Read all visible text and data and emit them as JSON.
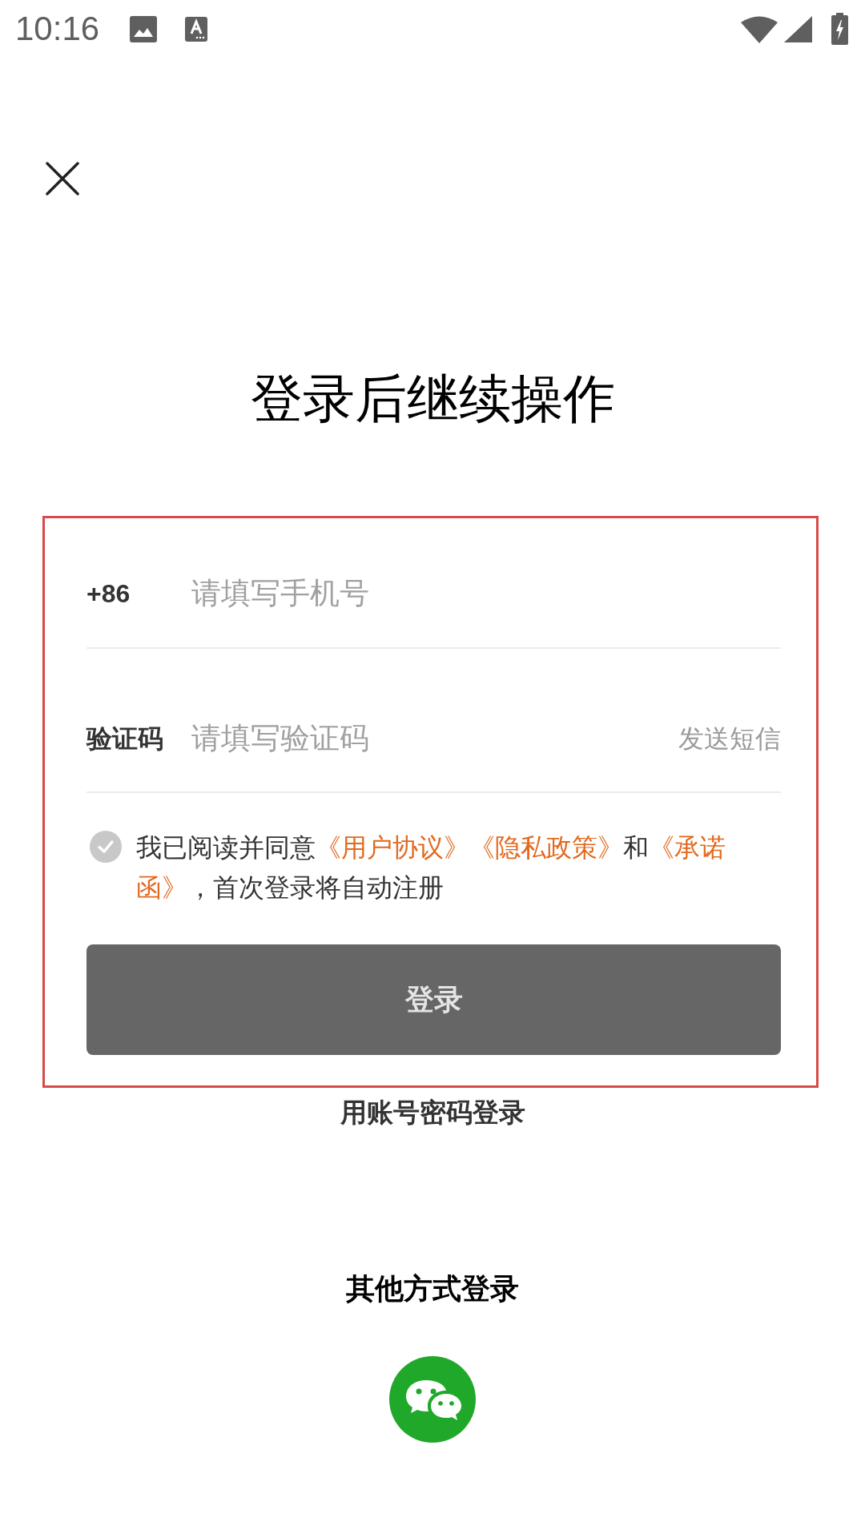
{
  "status_bar": {
    "time": "10:16"
  },
  "title": "登录后继续操作",
  "form": {
    "phone": {
      "prefix": "+86",
      "placeholder": "请填写手机号"
    },
    "code": {
      "label": "验证码",
      "placeholder": "请填写验证码",
      "send_code": "发送短信"
    },
    "agreement": {
      "checked": false,
      "segments": [
        {
          "kind": "text",
          "text": "我已阅读并同意"
        },
        {
          "kind": "link",
          "text": "《用户协议》"
        },
        {
          "kind": "link",
          "text": "《隐私政策》"
        },
        {
          "kind": "text",
          "text": "和"
        },
        {
          "kind": "link",
          "text": "《承诺"
        },
        {
          "kind": "link",
          "text": "函》"
        },
        {
          "kind": "text",
          "text": "，首次登录将自动注册"
        }
      ]
    },
    "login_button": {
      "label": "登录",
      "disabled": true
    }
  },
  "account_login": "用账号密码登录",
  "other_login": {
    "heading": "其他方式登录"
  }
}
